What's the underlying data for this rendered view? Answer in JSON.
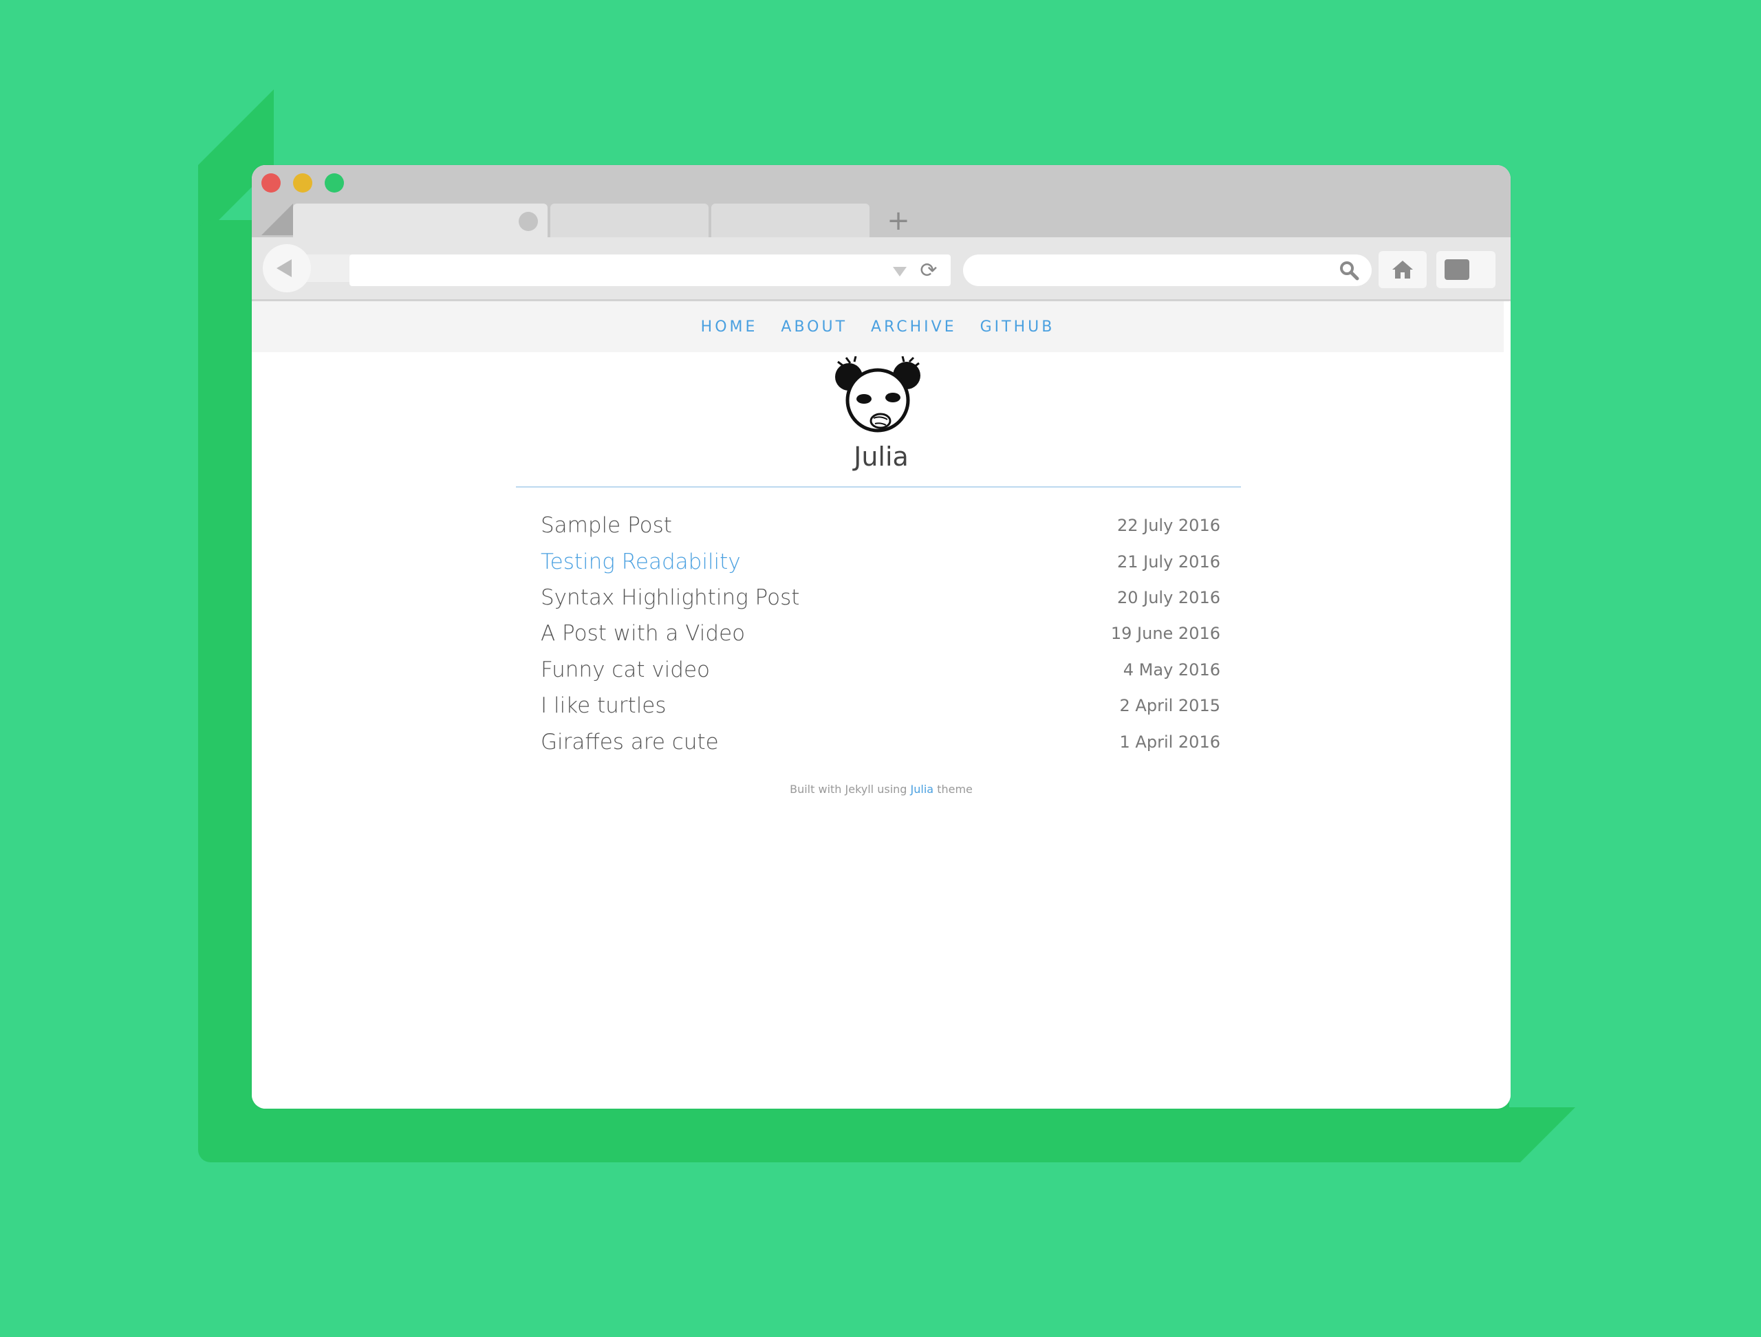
{
  "nav": {
    "items": [
      "HOME",
      "ABOUT",
      "ARCHIVE",
      "GITHUB"
    ]
  },
  "site": {
    "title": "Julia"
  },
  "posts": [
    {
      "title": "Sample Post",
      "date": "22 July 2016"
    },
    {
      "title": "Testing Readability",
      "date": "21 July 2016"
    },
    {
      "title": "Syntax Highlighting Post",
      "date": "20 July 2016"
    },
    {
      "title": "A Post with a Video",
      "date": "19 June 2016"
    },
    {
      "title": "Funny cat video",
      "date": "4 May 2016"
    },
    {
      "title": "I like turtles",
      "date": "2 April 2015"
    },
    {
      "title": "Giraffes are cute",
      "date": "1 April 2016"
    }
  ],
  "footer": {
    "prefix": "Built with Jekyll using",
    "link": "Julia",
    "suffix": "theme"
  },
  "colors": {
    "background": "#3ad688",
    "shadow": "#28c765",
    "link": "#4aa0e0"
  },
  "icons": {
    "new_tab": "+",
    "reload": "⟳"
  }
}
